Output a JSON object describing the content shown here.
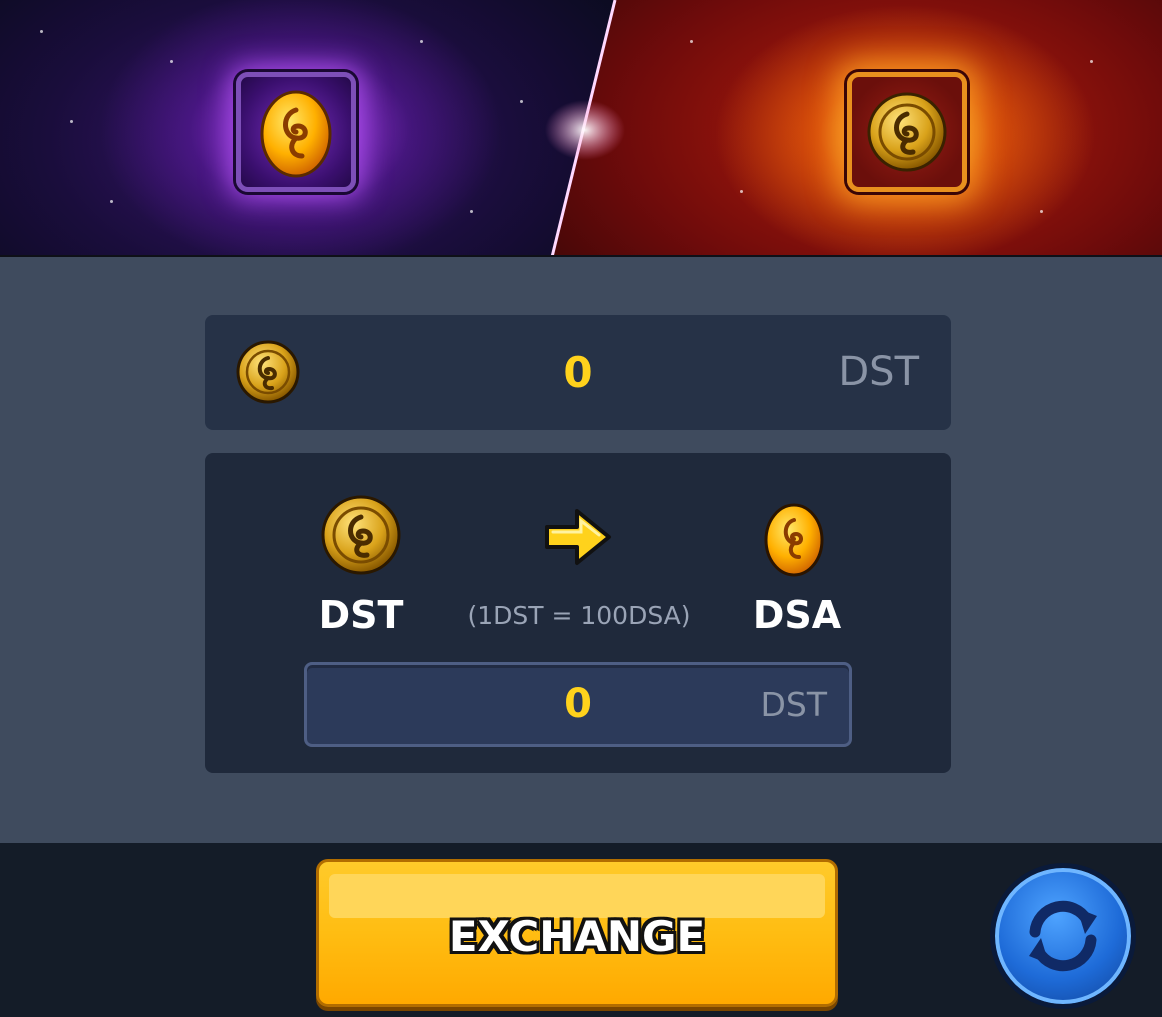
{
  "banner": {
    "left_icon": "dsa-egg-coin-icon",
    "right_icon": "dst-gold-coin-icon"
  },
  "balance": {
    "icon": "dst-coin-icon",
    "value": "0",
    "unit": "DST"
  },
  "exchange": {
    "from_icon": "dst-coin-icon",
    "from_label": "DST",
    "arrow_icon": "arrow-right-icon",
    "rate": "(1DST = 100DSA)",
    "to_icon": "dsa-coin-icon",
    "to_label": "DSA",
    "amount_value": "0",
    "amount_unit": "DST"
  },
  "buttons": {
    "exchange_label": "EXCHANGE",
    "refresh_icon": "refresh-icon"
  },
  "colors": {
    "accent_gold": "#ffd21c",
    "button_yellow": "#ffbd12",
    "panel_bg": "#3f4b5e",
    "card_bg": "#263247",
    "refresh_blue": "#1e6bd8"
  }
}
